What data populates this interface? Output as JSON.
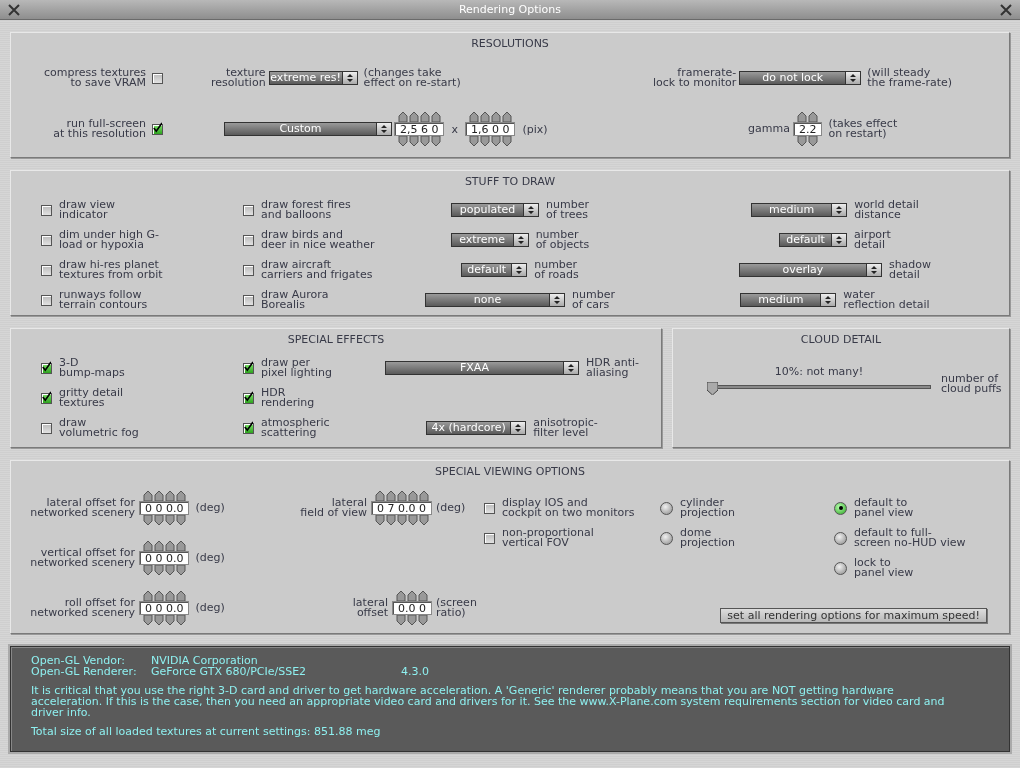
{
  "window": {
    "title": "Rendering Options"
  },
  "resolutions": {
    "title": "RESOLUTIONS",
    "compress_textures": {
      "label": "compress textures\nto save VRAM",
      "checked": false
    },
    "texture_resolution": {
      "label": "texture\nresolution",
      "value": "extreme res!",
      "note": "(changes take\neffect on re-start)"
    },
    "framerate_lock": {
      "label": "framerate-\nlock to monitor",
      "value": "do not lock",
      "note": "(will steady\nthe frame-rate)"
    },
    "full_screen": {
      "label": "run full-screen\nat this resolution",
      "checked": true
    },
    "resolution_preset": {
      "value": "Custom"
    },
    "screen_width": {
      "value": "2,5 6 0"
    },
    "separator": "x",
    "screen_height": {
      "value": "1,6 0 0"
    },
    "unit": "(pix)",
    "gamma": {
      "label": "gamma",
      "value": "2.2",
      "note": "(takes effect\non restart)"
    }
  },
  "stuff_to_draw": {
    "title": "STUFF TO DRAW",
    "columns": [
      {
        "kind": "checkboxes",
        "items": [
          {
            "label": "draw view\nindicator",
            "checked": false
          },
          {
            "label": "dim under high G-\nload or hypoxia",
            "checked": false
          },
          {
            "label": "draw hi-res planet\ntextures from orbit",
            "checked": false
          },
          {
            "label": "runways follow\nterrain contours",
            "checked": false
          }
        ]
      },
      {
        "kind": "checkboxes",
        "items": [
          {
            "label": "draw forest fires\nand balloons",
            "checked": false
          },
          {
            "label": "draw birds and\ndeer in nice weather",
            "checked": false
          },
          {
            "label": "draw aircraft\ncarriers and frigates",
            "checked": false
          },
          {
            "label": "draw Aurora\nBorealis",
            "checked": false
          }
        ]
      },
      {
        "kind": "dropdowns",
        "items": [
          {
            "value": "populated",
            "label": "number\nof trees"
          },
          {
            "value": "extreme",
            "label": "number\nof objects"
          },
          {
            "value": "default",
            "label": "number\nof roads"
          },
          {
            "value": "none",
            "label": "number\nof cars"
          }
        ]
      },
      {
        "kind": "dropdowns",
        "items": [
          {
            "value": "medium",
            "label": "world detail\ndistance"
          },
          {
            "value": "default",
            "label": "airport\ndetail"
          },
          {
            "value": "overlay",
            "label": "shadow\ndetail"
          },
          {
            "value": "medium",
            "label": "water\nreflection detail"
          }
        ]
      }
    ]
  },
  "special_effects": {
    "title": "SPECIAL EFFECTS",
    "columns": [
      {
        "kind": "checkboxes",
        "items": [
          {
            "label": "3-D\nbump-maps",
            "checked": true
          },
          {
            "label": "gritty detail\ntextures",
            "checked": true
          },
          {
            "label": "draw\nvolumetric fog",
            "checked": false
          }
        ]
      },
      {
        "kind": "checkboxes",
        "items": [
          {
            "label": "draw per\npixel lighting",
            "checked": true
          },
          {
            "label": "HDR\nrendering",
            "checked": true
          },
          {
            "label": "atmospheric\nscattering",
            "checked": true
          }
        ]
      },
      {
        "kind": "dropdowns",
        "items": [
          {
            "value": "FXAA",
            "label": "HDR anti-\naliasing"
          },
          {
            "value": "4x (hardcore)",
            "label": "anisotropic-\nfilter level"
          }
        ]
      }
    ]
  },
  "cloud_detail": {
    "title": "CLOUD DETAIL",
    "reading": "10%: not many!",
    "level": 0,
    "label": "number of\ncloud puffs"
  },
  "special_viewing": {
    "title": "SPECIAL VIEWING OPTIONS",
    "offsets": [
      {
        "label": "lateral offset for\nnetworked scenery",
        "value": "0 0 0.0",
        "unit": "(deg)"
      },
      {
        "label": "vertical offset for\nnetworked scenery",
        "value": "0 0 0.0",
        "unit": "(deg)"
      },
      {
        "label": "roll offset for\nnetworked scenery",
        "value": "0 0 0.0",
        "unit": "(deg)"
      }
    ],
    "lateral": [
      {
        "label": "lateral\nfield of view",
        "value": "0 7 0.0 0",
        "unit": "(deg)"
      },
      {
        "label": "lateral\noffset",
        "value": "0.0 0",
        "unit": "(screen\nratio)"
      }
    ],
    "checkboxes": [
      {
        "label": "display IOS and\ncockpit on two monitors",
        "checked": false
      },
      {
        "label": "non-proportional\nvertical FOV",
        "checked": false
      }
    ],
    "projection": [
      {
        "label": "cylinder\nprojection",
        "selected": false
      },
      {
        "label": "dome\nprojection",
        "selected": false
      }
    ],
    "view": [
      {
        "label": "default to\npanel view",
        "selected": true
      },
      {
        "label": "default to full-\nscreen no-HUD view",
        "selected": false
      },
      {
        "label": "lock to\npanel view",
        "selected": false
      }
    ],
    "button": "set all rendering options for maximum speed!"
  },
  "info": {
    "rows": [
      {
        "name": "Open-GL Vendor:",
        "value": "NVIDIA Corporation"
      },
      {
        "name": "Open-GL Renderer:",
        "value": "GeForce GTX 680/PCIe/SSE2",
        "version": "4.3.0"
      }
    ],
    "message": "It is critical that you use the right 3-D card and driver to get hardware acceleration. A 'Generic' renderer probably means that you are NOT getting hardware acceleration. If this is the case, then you need an appropriate video card and drivers for it. See the www.X-Plane.com system requirements section for video card and driver info.",
    "total": "Total size of all loaded textures at current settings: 851.88 meg"
  }
}
